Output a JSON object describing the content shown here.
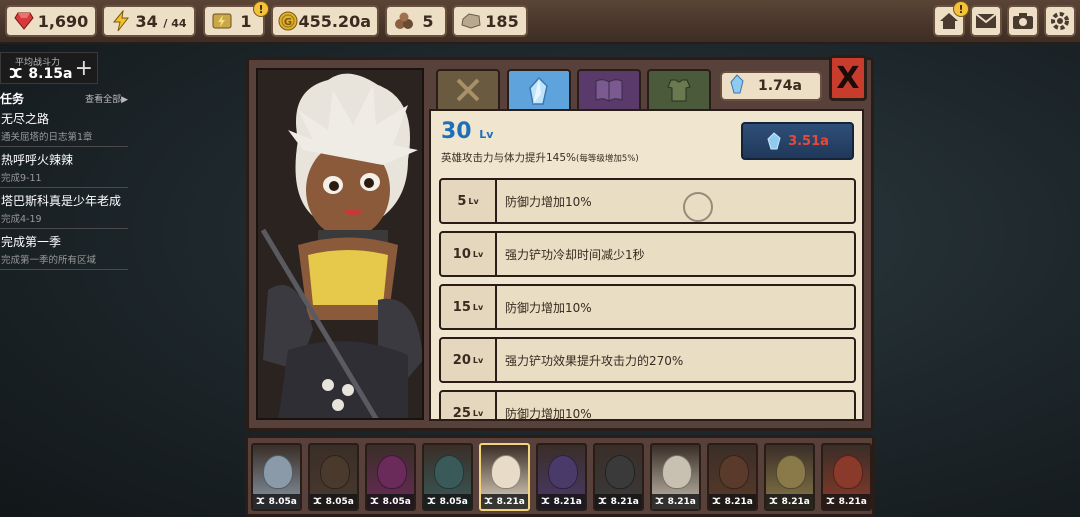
{
  "top_bar": {
    "gems": "1,690",
    "energy": "34",
    "energy_max": "/ 44",
    "keys": "1",
    "keys_badge": "!",
    "gold": "455.20a",
    "ore": "5",
    "stone": "185",
    "buttons": [
      "home-icon",
      "mail-icon",
      "camera-icon",
      "settings-icon"
    ],
    "home_badge": "!"
  },
  "power": {
    "label": "平均战斗力",
    "value": "ⵋ 8.15a",
    "plus": "+"
  },
  "quests": {
    "title": "任务",
    "view_all": "查看全部▶",
    "items": [
      {
        "name": "无尽之路",
        "desc": "通关屈塔的日志第1章"
      },
      {
        "name": "热呼呼火辣辣",
        "desc": "完成9-11"
      },
      {
        "name": "塔巴斯科真是少年老成",
        "desc": "完成4-19"
      },
      {
        "name": "完成第一季",
        "desc": "完成第一季的所有区域"
      }
    ]
  },
  "panel": {
    "tabs": [
      "swords-icon",
      "crystal-icon",
      "book-icon",
      "armor-icon"
    ],
    "active_tab": 1,
    "crystals": "1.74a",
    "close_label": "X",
    "level": "30",
    "level_unit": "Lv",
    "description": "英雄攻击力与体力提升145%",
    "description_note": "(每等级增加5%)",
    "upgrade_cost": "3.51a",
    "milestones": [
      {
        "level": "5",
        "text": "防御力增加10%"
      },
      {
        "level": "10",
        "text": "强力铲功冷却时间减少1秒"
      },
      {
        "level": "15",
        "text": "防御力增加10%"
      },
      {
        "level": "20",
        "text": "强力铲功效果提升攻击力的270%"
      },
      {
        "level": "25",
        "text": "防御力增加10%"
      }
    ],
    "milestone_unit": "Lv"
  },
  "heroes": [
    {
      "power": "ⵋ 8.05a",
      "color": "#8a9aa8"
    },
    {
      "power": "ⵋ 8.05a",
      "color": "#4a3a2e"
    },
    {
      "power": "ⵋ 8.05a",
      "color": "#6a2a5a"
    },
    {
      "power": "ⵋ 8.05a",
      "color": "#3a5a5a"
    },
    {
      "power": "ⵋ 8.21a",
      "color": "#e8dcc8"
    },
    {
      "power": "ⵋ 8.21a",
      "color": "#4a3a6a"
    },
    {
      "power": "ⵋ 8.21a",
      "color": "#3a3a3a"
    },
    {
      "power": "ⵋ 8.21a",
      "color": "#c8c0b0"
    },
    {
      "power": "ⵋ 8.21a",
      "color": "#5a3a2a"
    },
    {
      "power": "ⵋ 8.21a",
      "color": "#8a7a4a"
    },
    {
      "power": "ⵋ 8.21a",
      "color": "#8a3a2a"
    }
  ],
  "selected_hero": 4
}
